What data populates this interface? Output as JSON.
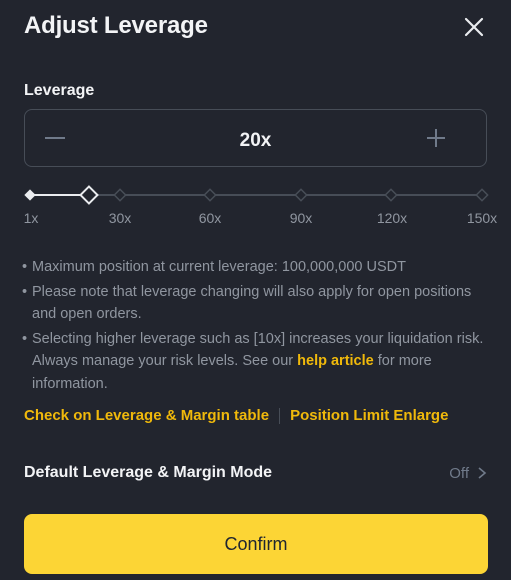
{
  "dialog": {
    "title": "Adjust Leverage",
    "close_icon": "close-icon"
  },
  "leverage": {
    "label": "Leverage",
    "value": "20x",
    "minus_icon": "minus-icon",
    "plus_icon": "plus-icon"
  },
  "slider": {
    "current": 20,
    "min": 1,
    "max": 150,
    "ticks": [
      "1x",
      "30x",
      "60x",
      "90x",
      "120x",
      "150x"
    ]
  },
  "notes": {
    "bullet": "•",
    "note1": "Maximum position at current leverage: 100,000,000 USDT",
    "note2": "Please note that leverage changing will also apply for open positions and open orders.",
    "note3_before": "Selecting higher leverage such as [10x] increases your liquidation risk. Always manage your risk levels. See our ",
    "note3_link": "help article",
    "note3_after": " for more information."
  },
  "links": {
    "table": "Check on Leverage & Margin table",
    "enlarge": "Position Limit Enlarge"
  },
  "default_mode": {
    "label": "Default Leverage & Margin Mode",
    "status": "Off",
    "chevron_icon": "chevron-right-icon"
  },
  "confirm": {
    "label": "Confirm"
  },
  "colors": {
    "background": "#22252e",
    "accent": "#fcd535",
    "link": "#f0b90b",
    "muted": "#9096a0"
  }
}
